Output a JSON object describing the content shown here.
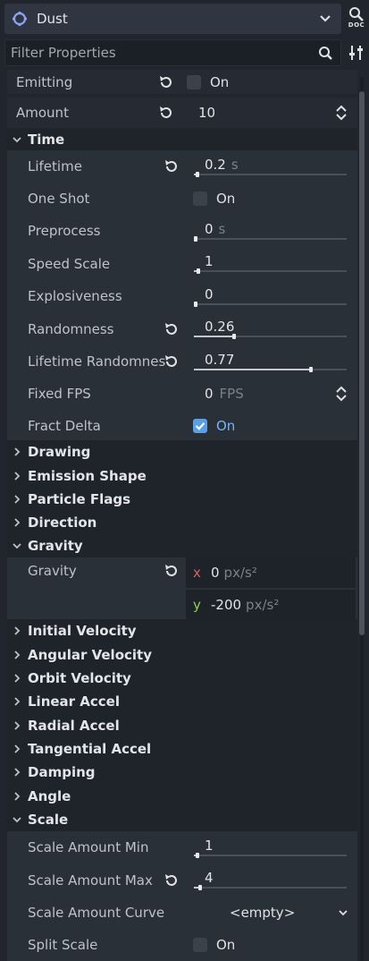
{
  "header": {
    "node_name": "Dust",
    "doc_label": "DOC",
    "filter_placeholder": "Filter Properties"
  },
  "top": {
    "emitting": {
      "label": "Emitting",
      "checked": false,
      "text": "On"
    },
    "amount": {
      "label": "Amount",
      "value": "10"
    }
  },
  "sections": {
    "time": "Time",
    "drawing": "Drawing",
    "emission_shape": "Emission Shape",
    "particle_flags": "Particle Flags",
    "direction": "Direction",
    "gravity": "Gravity",
    "initial_velocity": "Initial Velocity",
    "angular_velocity": "Angular Velocity",
    "orbit_velocity": "Orbit Velocity",
    "linear_accel": "Linear Accel",
    "radial_accel": "Radial Accel",
    "tangential_accel": "Tangential Accel",
    "damping": "Damping",
    "angle": "Angle",
    "scale": "Scale"
  },
  "time": {
    "lifetime": {
      "label": "Lifetime",
      "value": "0.2",
      "unit": "s",
      "ratio": 0.01
    },
    "one_shot": {
      "label": "One Shot",
      "checked": false,
      "text": "On"
    },
    "preprocess": {
      "label": "Preprocess",
      "value": "0",
      "unit": "s",
      "ratio": 0.0
    },
    "speed_scale": {
      "label": "Speed Scale",
      "value": "1",
      "ratio": 0.02
    },
    "explosiveness": {
      "label": "Explosiveness",
      "value": "0",
      "ratio": 0.0
    },
    "randomness": {
      "label": "Randomness",
      "value": "0.26",
      "ratio": 0.26
    },
    "lifetime_randomness": {
      "label": "Lifetime Randomness",
      "value": "0.77",
      "ratio": 0.77
    },
    "fixed_fps": {
      "label": "Fixed FPS",
      "value": "0",
      "unit": "FPS"
    },
    "fract_delta": {
      "label": "Fract Delta",
      "checked": true,
      "text": "On"
    }
  },
  "gravity": {
    "label": "Gravity",
    "x": {
      "axis": "x",
      "value": "0",
      "unit": "px/s²"
    },
    "y": {
      "axis": "y",
      "value": "-200",
      "unit": "px/s²"
    }
  },
  "scale": {
    "min": {
      "label": "Scale Amount Min",
      "value": "1",
      "ratio": 0.01
    },
    "max": {
      "label": "Scale Amount Max",
      "value": "4",
      "ratio": 0.03
    },
    "curve": {
      "label": "Scale Amount Curve",
      "value": "<empty>"
    },
    "split": {
      "label": "Split Scale",
      "checked": false,
      "text": "On"
    }
  },
  "colors": {
    "background": "#21262e",
    "property_bg": "#262b33",
    "accent": "#5aa0e6",
    "x_axis": "#e25b5b",
    "y_axis": "#8fd14c"
  }
}
